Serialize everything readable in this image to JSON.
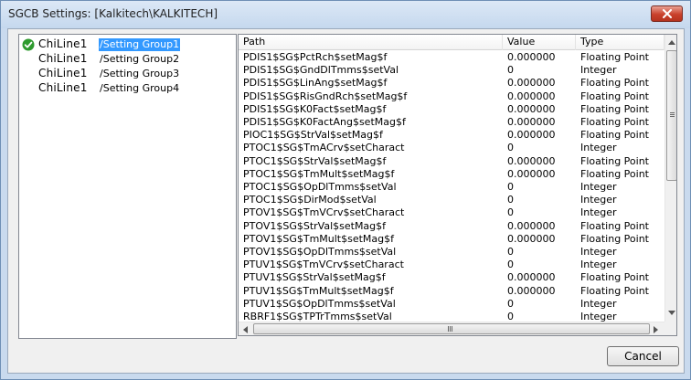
{
  "window": {
    "title": "SGCB Settings: [Kalkitech\\KALKITECH]",
    "close_icon": "close-icon"
  },
  "tree": {
    "items": [
      {
        "name": "ChiLine1",
        "group": "/Setting Group1",
        "selected": true,
        "icon": "check-circle-icon"
      },
      {
        "name": "ChiLine1",
        "group": "/Setting Group2",
        "selected": false
      },
      {
        "name": "ChiLine1",
        "group": "/Setting Group3",
        "selected": false
      },
      {
        "name": "ChiLine1",
        "group": "/Setting Group4",
        "selected": false
      }
    ]
  },
  "grid": {
    "columns": [
      "Path",
      "Value",
      "Type"
    ],
    "rows": [
      [
        "PDIS1$SG$PctRch$setMag$f",
        "0.000000",
        "Floating Point"
      ],
      [
        "PDIS1$SG$GndDlTmms$setVal",
        "0",
        "Integer"
      ],
      [
        "PDIS1$SG$LinAng$setMag$f",
        "0.000000",
        "Floating Point"
      ],
      [
        "PDIS1$SG$RisGndRch$setMag$f",
        "0.000000",
        "Floating Point"
      ],
      [
        "PDIS1$SG$K0Fact$setMag$f",
        "0.000000",
        "Floating Point"
      ],
      [
        "PDIS1$SG$K0FactAng$setMag$f",
        "0.000000",
        "Floating Point"
      ],
      [
        "PIOC1$SG$StrVal$setMag$f",
        "0.000000",
        "Floating Point"
      ],
      [
        "PTOC1$SG$TmACrv$setCharact",
        "0",
        "Integer"
      ],
      [
        "PTOC1$SG$StrVal$setMag$f",
        "0.000000",
        "Floating Point"
      ],
      [
        "PTOC1$SG$TmMult$setMag$f",
        "0.000000",
        "Floating Point"
      ],
      [
        "PTOC1$SG$OpDlTmms$setVal",
        "0",
        "Integer"
      ],
      [
        "PTOC1$SG$DirMod$setVal",
        "0",
        "Integer"
      ],
      [
        "PTOV1$SG$TmVCrv$setCharact",
        "0",
        "Integer"
      ],
      [
        "PTOV1$SG$StrVal$setMag$f",
        "0.000000",
        "Floating Point"
      ],
      [
        "PTOV1$SG$TmMult$setMag$f",
        "0.000000",
        "Floating Point"
      ],
      [
        "PTOV1$SG$OpDlTmms$setVal",
        "0",
        "Integer"
      ],
      [
        "PTUV1$SG$TmVCrv$setCharact",
        "0",
        "Integer"
      ],
      [
        "PTUV1$SG$StrVal$setMag$f",
        "0.000000",
        "Floating Point"
      ],
      [
        "PTUV1$SG$TmMult$setMag$f",
        "0.000000",
        "Floating Point"
      ],
      [
        "PTUV1$SG$OpDlTmms$setVal",
        "0",
        "Integer"
      ],
      [
        "RBRF1$SG$TPTrTmms$setVal",
        "0",
        "Integer"
      ]
    ]
  },
  "buttons": {
    "cancel": "Cancel"
  },
  "colors": {
    "selection": "#3399ff",
    "check_green": "#2e9a2e",
    "close_red": "#c9402b"
  }
}
